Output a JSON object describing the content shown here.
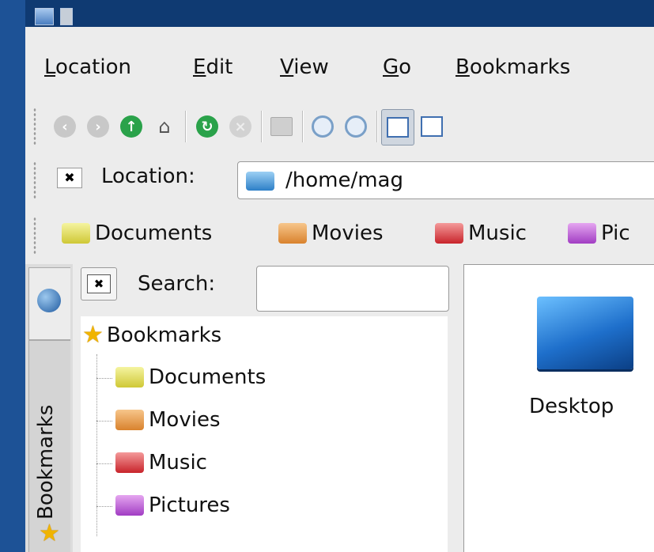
{
  "menu": {
    "items": [
      {
        "label": "Location",
        "accel": "L"
      },
      {
        "label": "Edit",
        "accel": "E"
      },
      {
        "label": "View",
        "accel": "V"
      },
      {
        "label": "Go",
        "accel": "G"
      },
      {
        "label": "Bookmarks",
        "accel": "B"
      }
    ]
  },
  "toolbar": {
    "icons": [
      "back-icon",
      "forward-icon",
      "up-icon",
      "home-icon",
      "reload-icon",
      "stop-icon",
      "print-icon",
      "zoom-in-icon",
      "zoom-out-icon",
      "icon-view-icon",
      "detail-view-icon"
    ]
  },
  "location": {
    "label": "Location:",
    "value": "/home/mag"
  },
  "bookmark_bar": {
    "items": [
      {
        "label": "Documents",
        "color": "#d6cf3b"
      },
      {
        "label": "Movies",
        "color": "#de8a36"
      },
      {
        "label": "Music",
        "color": "#cc2a31"
      },
      {
        "label": "Pic",
        "color": "#a64bc9"
      }
    ]
  },
  "sidebar": {
    "tab_label": "Bookmarks",
    "search_label": "Search:",
    "search_value": "",
    "tree": {
      "root": "Bookmarks",
      "children": [
        "Documents",
        "Movies",
        "Music",
        "Pictures"
      ]
    }
  },
  "view": {
    "items": [
      {
        "label": "Desktop",
        "icon": "desktop-folder-icon"
      }
    ]
  },
  "colors": {
    "title_bar": "#0f3a72",
    "window_bg": "#ececec",
    "desktop_blue": "#1e6fcb"
  }
}
